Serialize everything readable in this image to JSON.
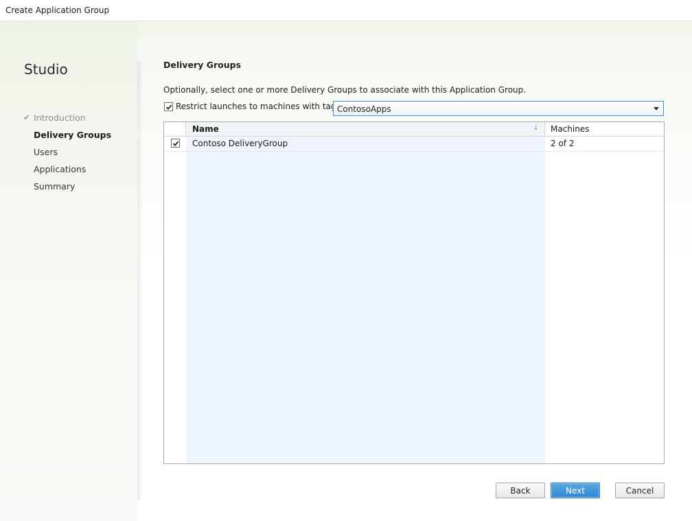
{
  "window": {
    "title": "Create Application Group"
  },
  "sidebar": {
    "brand": "Studio",
    "steps": [
      {
        "label": "Introduction",
        "state": "done"
      },
      {
        "label": "Delivery Groups",
        "state": "current"
      },
      {
        "label": "Users",
        "state": "pending"
      },
      {
        "label": "Applications",
        "state": "pending"
      },
      {
        "label": "Summary",
        "state": "pending"
      }
    ]
  },
  "main": {
    "title": "Delivery Groups",
    "description": "Optionally, select one or more Delivery Groups to associate with this Application Group.",
    "restrict": {
      "label": "Restrict launches to machines with tag:",
      "checked": true
    },
    "tag_select": {
      "value": "ContosoApps"
    },
    "grid": {
      "columns": [
        "Name",
        "Machines"
      ],
      "rows": [
        {
          "checked": true,
          "name": "Contoso DeliveryGroup",
          "machines": "2 of 2"
        }
      ]
    }
  },
  "footer": {
    "back_label": "Back",
    "next_label": "Next",
    "cancel_label": "Cancel"
  },
  "colors": {
    "accent": "#3f8fd6",
    "primary_button": "#2f86cf",
    "name_column_bg": "#eef5fd"
  }
}
